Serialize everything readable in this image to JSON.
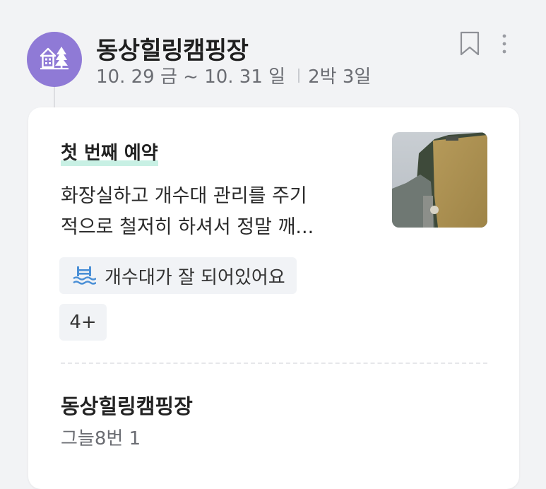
{
  "header": {
    "title": "동상힐링캠핑장",
    "date_range": "10. 29 금 ~ 10. 31 일",
    "duration": "2박 3일",
    "avatar_icon": "cabin-trees-icon",
    "bookmark_icon": "bookmark-icon",
    "more_icon": "more-vertical-icon",
    "avatar_color": "#8f7ad6"
  },
  "review": {
    "heading": "첫 번째 예약",
    "text_line1": "화장실하고 개수대 관리를 주기",
    "text_line2": "적으로 철저히 하셔서 정말 깨...",
    "thumbnail_icon": "campsite-photo",
    "tag": {
      "icon": "water-sink-icon",
      "label": "개수대가 잘 되어있어요"
    },
    "more_tags": "4+"
  },
  "site": {
    "name": "동상힐링캠핑장",
    "detail": "그늘8번 1"
  }
}
